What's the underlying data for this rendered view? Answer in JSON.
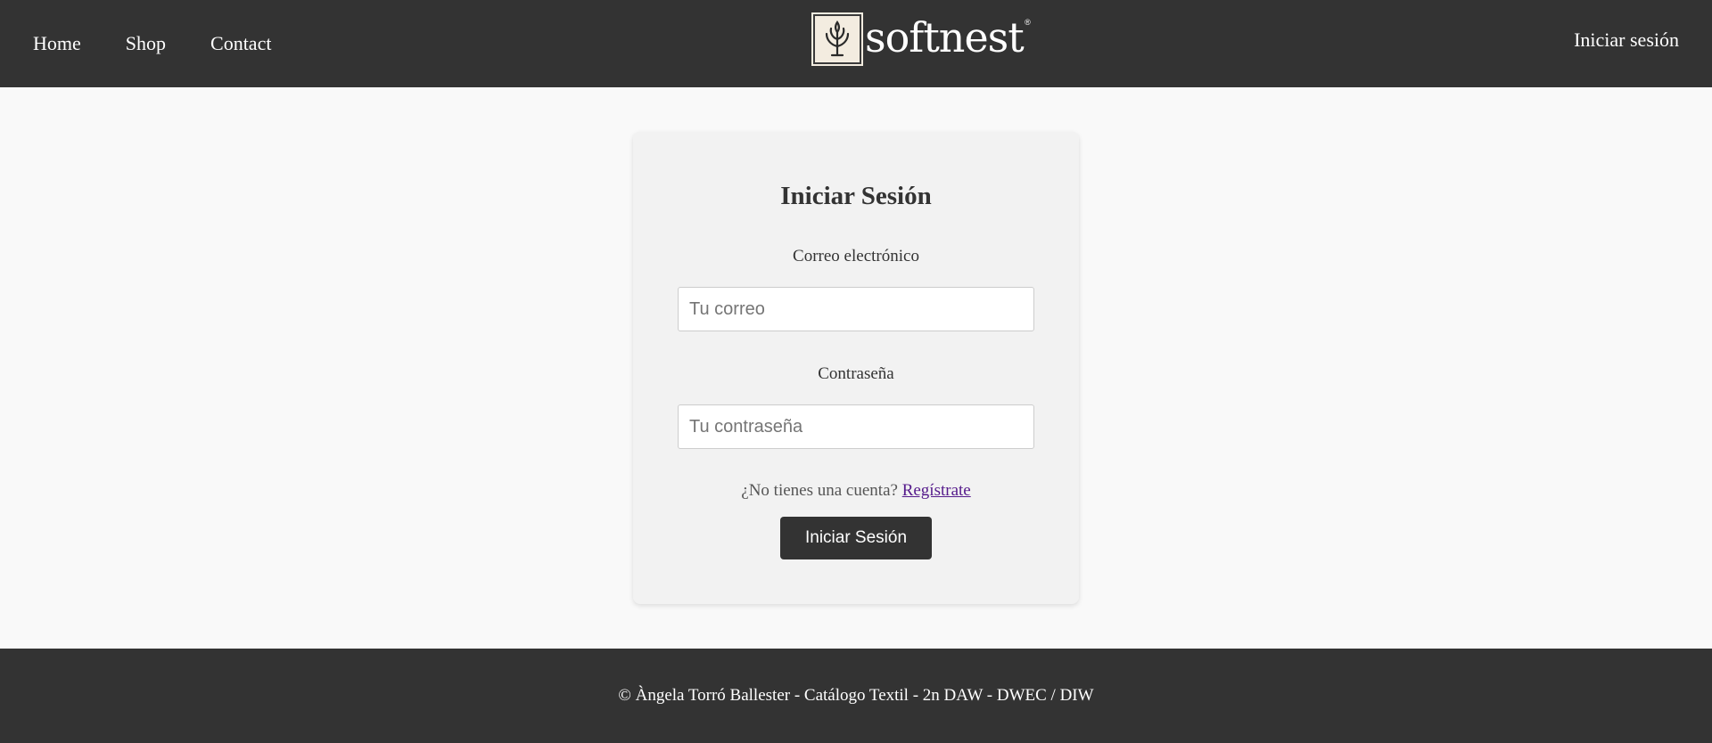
{
  "header": {
    "nav": [
      {
        "label": "Home"
      },
      {
        "label": "Shop"
      },
      {
        "label": "Contact"
      }
    ],
    "logo_text": "softnest",
    "logo_mark": "®",
    "logo_icon": "sprig-icon",
    "login_label": "Iniciar sesión"
  },
  "login_form": {
    "title": "Iniciar Sesión",
    "email_label": "Correo electrónico",
    "email_placeholder": "Tu correo",
    "password_label": "Contraseña",
    "password_placeholder": "Tu contraseña",
    "register_prompt": "¿No tienes una cuenta?",
    "register_link": "Regístrate",
    "submit_label": "Iniciar Sesión"
  },
  "footer": {
    "text": "© Àngela Torró Ballester - Catálogo Textil - 2n DAW - DWEC / DIW"
  },
  "colors": {
    "header_bg": "#333333",
    "page_bg": "#f9f9f9",
    "card_bg": "#f2f2f2",
    "button_bg": "#333333",
    "link_visited": "#551a8b"
  }
}
